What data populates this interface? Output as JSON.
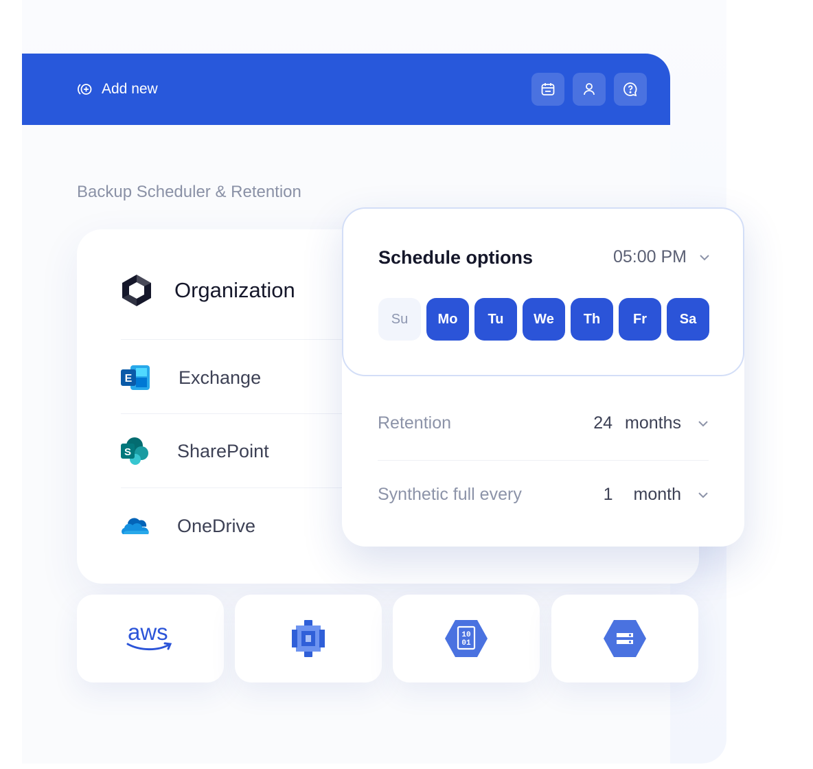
{
  "header": {
    "add_new_label": "Add new",
    "icons": [
      "calendar-icon",
      "user-icon",
      "help-icon"
    ],
    "color": "#2858db"
  },
  "section_title": "Backup Scheduler & Retention",
  "organization": {
    "title": "Organization",
    "services": [
      {
        "label": "Exchange",
        "icon": "exchange-icon"
      },
      {
        "label": "SharePoint",
        "icon": "sharepoint-icon"
      },
      {
        "label": "OneDrive",
        "icon": "onedrive-icon"
      }
    ]
  },
  "schedule": {
    "title": "Schedule options",
    "time": "05:00 PM",
    "days": [
      {
        "label": "Su",
        "selected": false
      },
      {
        "label": "Mo",
        "selected": true
      },
      {
        "label": "Tu",
        "selected": true
      },
      {
        "label": "We",
        "selected": true
      },
      {
        "label": "Th",
        "selected": true
      },
      {
        "label": "Fr",
        "selected": true
      },
      {
        "label": "Sa",
        "selected": true
      }
    ]
  },
  "retention": {
    "label": "Retention",
    "value": "24",
    "unit": "months"
  },
  "synthetic": {
    "label": "Synthetic full every",
    "value": "1",
    "unit": "month"
  },
  "storage": {
    "aws_label": "aws",
    "icons": [
      "aws-logo",
      "azure-storage-icon",
      "binary-storage-icon",
      "storage-server-icon"
    ]
  },
  "accent_color": "#2b54d8"
}
